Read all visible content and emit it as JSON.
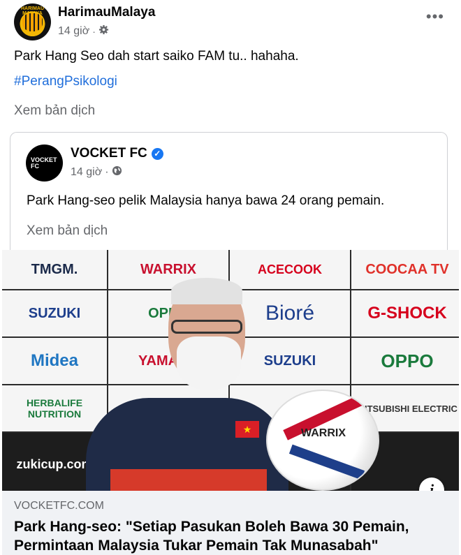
{
  "post": {
    "author": "HarimauMalaya",
    "avatar_text": "HARIMAU MALAYA",
    "time": "14 giờ",
    "audience_icon": "gear-icon",
    "text": "Park Hang Seo dah start saiko FAM tu.. hahaha.",
    "hashtag": "#PerangPsikologi",
    "translate_label": "Xem bản dịch",
    "more_label": "•••"
  },
  "shared_post": {
    "author": "VOCKET FC",
    "avatar_text": "VOCKET FC",
    "verified_mark": "✓",
    "time": "14 giờ",
    "audience_icon": "globe-icon",
    "text": "Park Hang-seo pelik Malaysia hanya bawa 24 orang pemain.",
    "translate_label": "Xem bản dịch"
  },
  "photo": {
    "sponsors": [
      "TMGM.",
      "WARRIX",
      "ACECOOK",
      "COOCAA TV",
      "SUZUKI",
      "OPPO",
      "Bioré",
      "G-SHOCK",
      "Midea",
      "YAMAHA",
      "SUZUKI",
      "OPPO",
      "HERBALIFE NUTRITION",
      "",
      "",
      "MITSUBISHI ELECTRIC",
      "zukicup.com",
      "",
      "",
      ""
    ],
    "ball_brand": "WARRIX",
    "info_label": "i"
  },
  "link": {
    "domain": "VOCKETFC.COM",
    "headline": "Park Hang-seo: \"Setiap Pasukan Boleh Bawa 30 Pemain, Permintaan Malaysia Tukar Pemain Tak Munasabah\""
  },
  "colors": {
    "link_blue": "#216fdb",
    "secondary_text": "#65676b",
    "verified_blue": "#1877f2",
    "preview_bg": "#f0f2f5"
  }
}
